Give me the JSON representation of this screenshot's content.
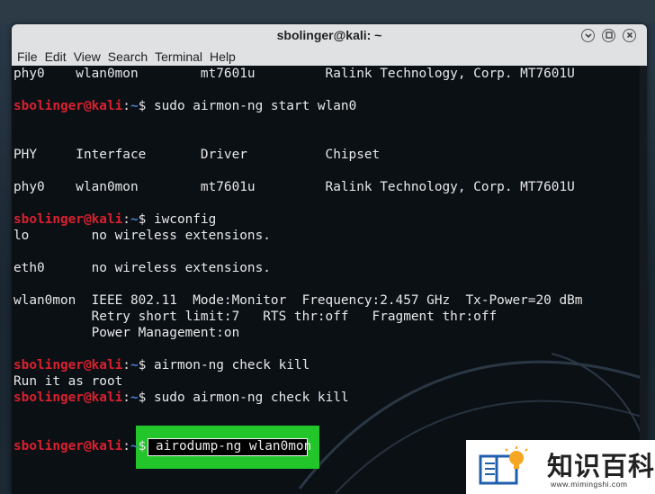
{
  "window": {
    "title": "sbolinger@kali: ~",
    "minimize": "⌄",
    "maximize": "^",
    "close": "×"
  },
  "menu": [
    "File",
    "Edit",
    "View",
    "Search",
    "Terminal",
    "Help"
  ],
  "terminal": {
    "prompt_user": "sbolinger@kali",
    "prompt_path": "~",
    "lines": {
      "l1": "phy0    wlan0mon        mt7601u         Ralink Technology, Corp. MT7601U",
      "cmd1": "sudo airmon-ng start wlan0",
      "hdr": "PHY     Interface       Driver          Chipset",
      "l2": "phy0    wlan0mon        mt7601u         Ralink Technology, Corp. MT7601U",
      "cmd2": "iwconfig",
      "lo": "lo        no wireless extensions.",
      "eth0": "eth0      no wireless extensions.",
      "wlan1": "wlan0mon  IEEE 802.11  Mode:Monitor  Frequency:2.457 GHz  Tx-Power=20 dBm",
      "wlan2": "          Retry short limit:7   RTS thr:off   Fragment thr:off",
      "wlan3": "          Power Management:on",
      "cmd3": "airmon-ng check kill",
      "root": "Run it as root",
      "cmd4": "sudo airmon-ng check kill",
      "cmd5": "airodump-ng wlan0mon"
    }
  },
  "watermark": {
    "text": "知识百科",
    "url": "www.mimingshi.com"
  }
}
